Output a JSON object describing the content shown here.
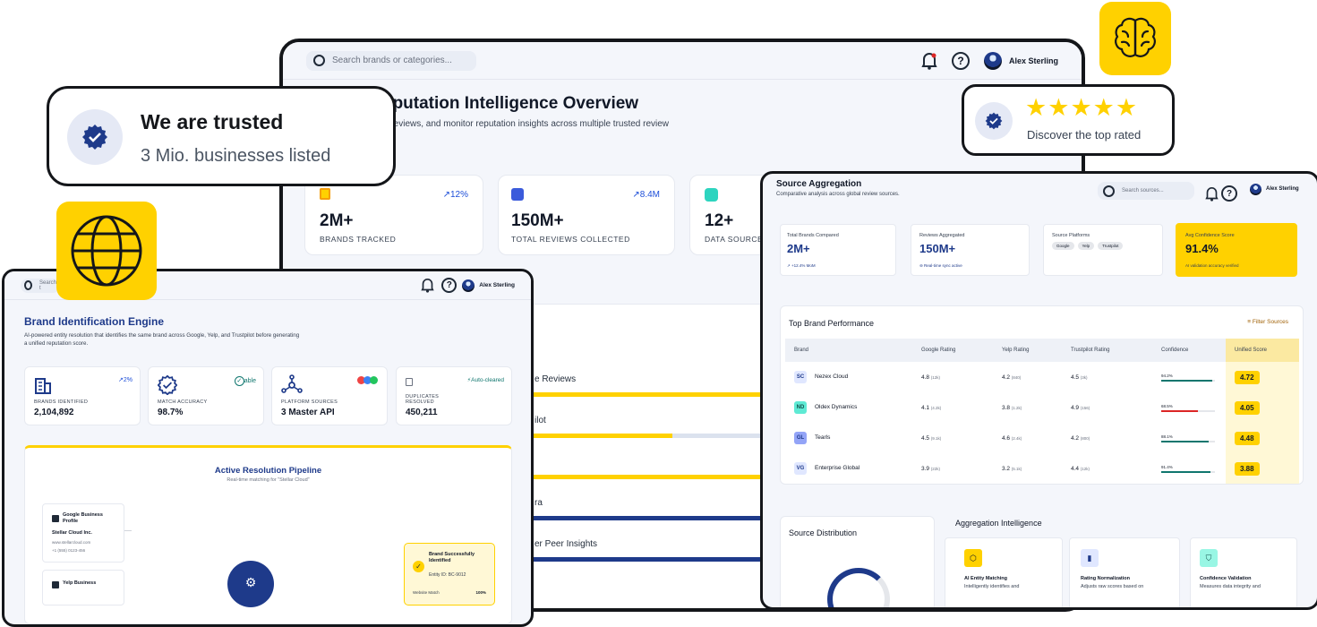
{
  "colors": {
    "accent_yellow": "#FFD100",
    "brand_blue": "#1E3A8A",
    "teal": "#0F766E",
    "red": "#DC2626"
  },
  "center_window": {
    "search_placeholder": "Search brands or categories...",
    "user": "Alex Sterling",
    "title": "eputation Intelligence Overview",
    "subtitle": "e reviews, and monitor reputation insights across multiple trusted review",
    "stats": [
      {
        "value": "2M+",
        "label": "BRANDS TRACKED",
        "trend": "12%",
        "icon": "building-icon"
      },
      {
        "value": "150M+",
        "label": "TOTAL REVIEWS COLLECTED",
        "trend": "8.4M",
        "icon": "document-icon"
      },
      {
        "value": "12+",
        "label": "DATA SOURCES",
        "icon": "nodes-icon"
      }
    ],
    "bars": [
      {
        "label": "e Reviews",
        "fill": 1.0,
        "color": "#FFD100"
      },
      {
        "label": "ilot",
        "fill": 0.55,
        "color": "#FFD100"
      },
      {
        "label": "",
        "fill": 1.0,
        "color": "#FFD100"
      },
      {
        "label": "ra",
        "fill": 1.0,
        "color": "#1E3A8A"
      },
      {
        "label": "er Peer Insights",
        "fill": 1.0,
        "color": "#1E3A8A"
      }
    ]
  },
  "trusted_card": {
    "title": "We are trusted",
    "subtitle": "3 Mio. businesses listed"
  },
  "rated_card": {
    "caption": "Discover the top rated",
    "stars": 5
  },
  "left_window": {
    "search_placeholder": "Search t",
    "user": "Alex Sterling",
    "title": "Brand Identification Engine",
    "description": "AI-powered entity resolution that identifies the same brand across Google, Yelp, and Trustpilot before generating a unified reputation score.",
    "stats": [
      {
        "label": "BRANDS IDENTIFIED",
        "value": "2,104,892",
        "trend": "2%"
      },
      {
        "label": "MATCH ACCURACY",
        "value": "98.7%",
        "trend": "able"
      },
      {
        "label": "PLATFORM SOURCES",
        "value": "3 Master API"
      },
      {
        "label": "DUPLICATES RESOLVED",
        "value": "450,211",
        "trend": "Auto-cleared"
      }
    ],
    "pipeline": {
      "title": "Active Resolution Pipeline",
      "subtitle": "Real-time matching for \"Stellar Cloud\"",
      "source1_title": "Google Business Profile",
      "source1_name": "Stellar Cloud Inc.",
      "source1_url": "www.stellarcloud.com",
      "source1_phone": "+1 (555) 0123-456",
      "source2_title": "Yelp Business",
      "result_title": "Brand Successfully Identified",
      "result_id": "Entity ID: BC-9012",
      "result_row_label": "Website Match",
      "result_row_value": "100%"
    }
  },
  "right_window": {
    "title": "Source Aggregation",
    "subtitle": "Comparative analysis across global review sources.",
    "search_placeholder": "Search sources...",
    "user": "Alex Sterling",
    "kpis": [
      {
        "label": "Total Brands Compared",
        "value": "2M+",
        "note": "+12.4% MoM"
      },
      {
        "label": "Reviews Aggregated",
        "value": "150M+",
        "note": "Real-time sync active"
      },
      {
        "label": "Source Platforms",
        "chips": [
          "Google",
          "Yelp",
          "Trustpilot"
        ]
      },
      {
        "label": "Avg Confidence Score",
        "value": "91.4%",
        "note": "AI validation accuracy verified"
      }
    ],
    "table": {
      "title": "Top Brand Performance",
      "filter_label": "Filter Sources",
      "headers": [
        "Brand",
        "Google Rating",
        "Yelp Rating",
        "Trustpilot Rating",
        "Confidence",
        "Unified Score"
      ],
      "rows": [
        {
          "code": "SC",
          "name": "Nezex Cloud",
          "google": "4.8",
          "google_n": "(12k)",
          "yelp": "4.2",
          "yelp_n": "(840)",
          "trust": "4.5",
          "trust_n": "(3k)",
          "conf": "94.2%",
          "conf_value": 0.942,
          "conf_color": "#0F766E",
          "score": "4.72",
          "badge_bg": "#e0e7ff",
          "badge_fg": "#1e3a8a"
        },
        {
          "code": "ND",
          "name": "Oldex Dynamics",
          "google": "4.1",
          "google_n": "(4.2k)",
          "yelp": "3.8",
          "yelp_n": "(1.2k)",
          "trust": "4.9",
          "trust_n": "(156)",
          "conf": "68.5%",
          "conf_value": 0.685,
          "conf_color": "#DC2626",
          "score": "4.05",
          "badge_bg": "#5eead4",
          "badge_fg": "#134e4a"
        },
        {
          "code": "GL",
          "name": "Tearls",
          "google": "4.5",
          "google_n": "(9.1k)",
          "yelp": "4.6",
          "yelp_n": "(2.4k)",
          "trust": "4.2",
          "trust_n": "(800)",
          "conf": "88.1%",
          "conf_value": 0.881,
          "conf_color": "#0F766E",
          "score": "4.48",
          "badge_bg": "#93a4f7",
          "badge_fg": "#1e3a8a"
        },
        {
          "code": "VG",
          "name": "Enterprise Global",
          "google": "3.9",
          "google_n": "(22k)",
          "yelp": "3.2",
          "yelp_n": "(5.1k)",
          "trust": "4.4",
          "trust_n": "(12k)",
          "conf": "91.4%",
          "conf_value": 0.914,
          "conf_color": "#0F766E",
          "score": "3.88",
          "badge_bg": "#e0e7ff",
          "badge_fg": "#1e3a8a"
        }
      ]
    },
    "distribution_title": "Source Distribution",
    "intelligence_title": "Aggregation Intelligence",
    "intel_cards": [
      {
        "title": "AI Entity Matching",
        "desc": "Intelligently identifies and"
      },
      {
        "title": "Rating Normalization",
        "desc": "Adjusts raw scores based on"
      },
      {
        "title": "Confidence Validation",
        "desc": "Measures data integrity and"
      }
    ]
  }
}
